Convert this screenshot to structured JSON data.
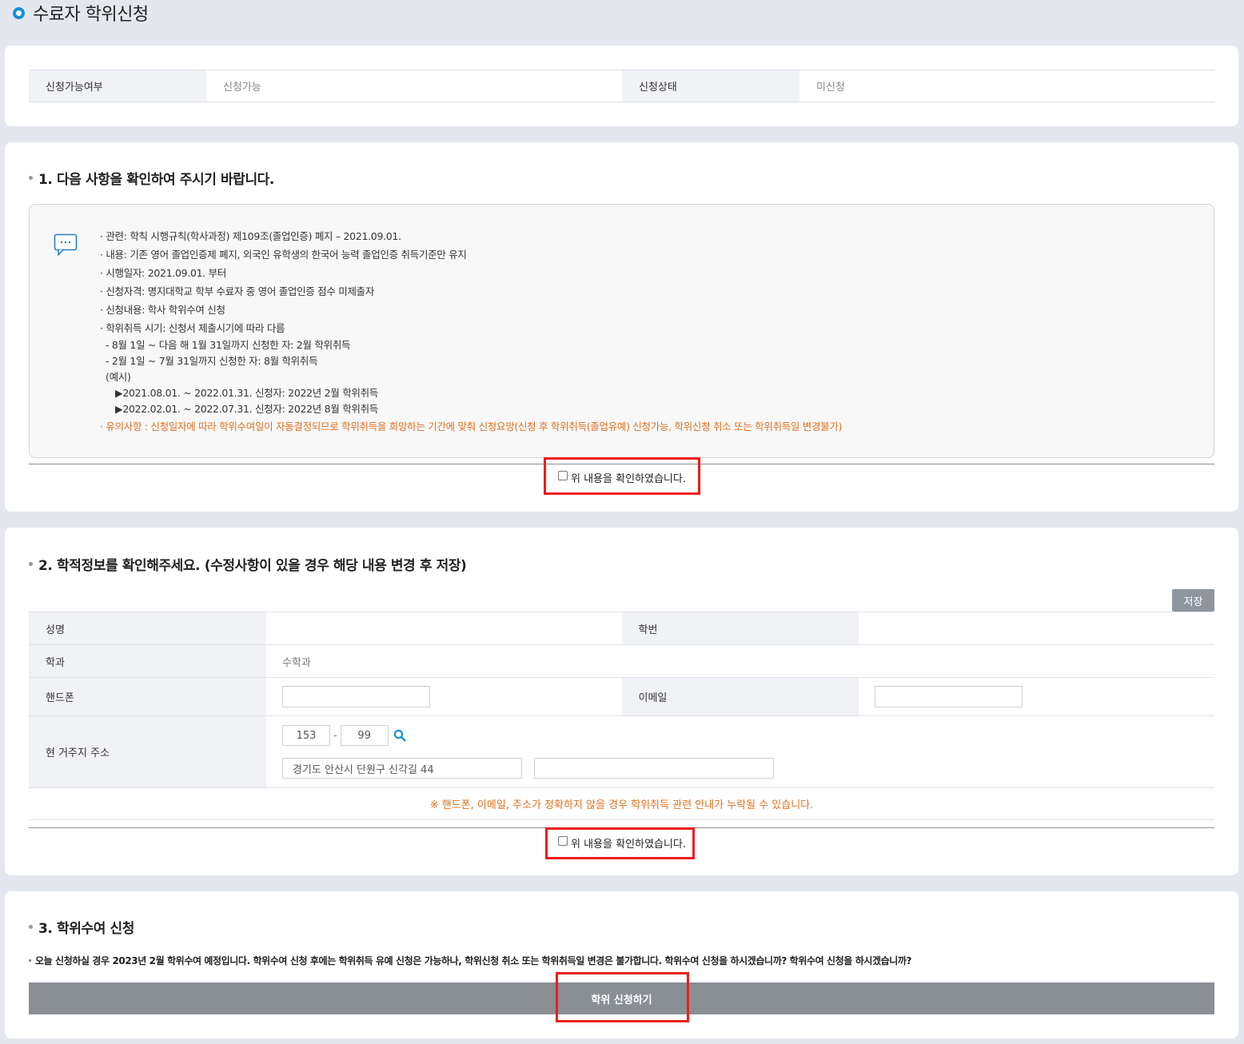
{
  "page": {
    "title": "수료자 학위신청"
  },
  "status": {
    "available_label": "신청가능여부",
    "available_value": "신청가능",
    "state_label": "신청상태",
    "state_value": "미신청"
  },
  "section1": {
    "title": "1. 다음 사항을 확인하여 주시기 바랍니다.",
    "notices": [
      "· 관련: 학칙 시행규칙(학사과정) 제109조(졸업인증) 폐지 – 2021.09.01.",
      "· 내용: 기존 영어 졸업인증제 폐지, 외국인 유학생의 한국어 능력 졸업인증 취득기준만 유지",
      "· 시행일자: 2021.09.01. 부터",
      "· 신청자격: 명지대학교 학부 수료자 중 영어 졸업인증 점수 미제출자",
      "· 신청내용: 학사 학위수여 신청",
      "· 학위취득 시기: 신청서 제출시기에 따라 다름"
    ],
    "sub_items": [
      "- 8월 1일 ~ 다음 해 1월 31일까지 신청한 자: 2월 학위취득",
      "- 2월 1일 ~ 7월 31일까지 신청한 자: 8월 학위취득",
      "(예시)"
    ],
    "examples": [
      "▶2021.08.01. ~ 2022.01.31. 신청자: 2022년 2월 학위취득",
      "▶2022.02.01. ~ 2022.07.31. 신청자: 2022년 8월 학위취득"
    ],
    "warning": "· 유의사항 : 신청일자에 따라 학위수여일이 자동결정되므로 학위취득을 희망하는 기간에 맞춰 신청요망(신청 후 학위취득(졸업유예) 신청가능, 학위신청 취소 또는 학위취득일 변경불가)",
    "confirm_label": "위 내용을 확인하였습니다."
  },
  "section2": {
    "title": "2. 학적정보를 확인해주세요. (수정사항이 있을 경우 해당 내용 변경 후 저장)",
    "save_label": "저장",
    "name_label": "성명",
    "name_value": "",
    "student_id_label": "학번",
    "student_id_value": "",
    "dept_label": "학과",
    "dept_value": "수학과",
    "phone_label": "핸드폰",
    "phone_value": "",
    "email_label": "이메일",
    "email_value": "",
    "address_label": "현 거주지 주소",
    "zip1": "153",
    "zip_sep": "-",
    "zip2": "99",
    "address1": "경기도 안산시 단원구 신각길 44",
    "address2": "",
    "note": "※ 핸드폰, 이메일, 주소가 정확하지 않을 경우 학위취득 관련 안내가 누락될 수 있습니다.",
    "confirm_label": "위 내용을 확인하였습니다."
  },
  "section3": {
    "title": "3. 학위수여 신청",
    "text": "오늘 신청하실 경우 2023년 2월 학위수여 예정입니다. 학위수여 신청 후에는 학위취득 유예 신청은 가능하나, 학위신청 취소 또는 학위취득일 변경은 불가합니다. 학위수여 신청을 하시겠습니까? 학위수여 신청을 하시겠습니까?",
    "button_label": "학위 신청하기"
  },
  "colors": {
    "accent": "#1a8fd8",
    "warning": "#e07020",
    "highlight": "#ee1c1c",
    "button": "#8a8f96"
  },
  "icons": {
    "title": "circle-bullet-icon",
    "notice": "chat-bubble-icon",
    "search": "search-icon"
  }
}
